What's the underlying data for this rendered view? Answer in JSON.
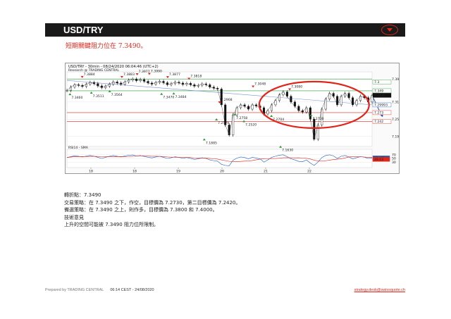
{
  "header": {
    "title": "USD/TRY"
  },
  "headline": "短期關鍵阻力位在  7.3490。",
  "chart": {
    "title": "USD/TRY - 30min - 08/24/2020 06:04:46 (UTC+2)",
    "source": "Research @ TRADING CENTRAL",
    "indicator_label": "RSI14 - SMA",
    "colors": {
      "resistance": "#2a9a3a",
      "support": "#e0251b",
      "ellipse": "#e0251b",
      "arrow": "#1f5fbf",
      "rsi": "#1f5fbf",
      "sma": "#e0251b"
    },
    "price_ticks": [
      {
        "label": "7.39",
        "value": 7.39
      },
      {
        "label": "7.31",
        "value": 7.31
      },
      {
        "label": "7.25",
        "value": 7.25
      },
      {
        "label": "7.19",
        "value": 7.19
      }
    ],
    "price_tags": [
      {
        "label": "7.3",
        "value": 7.38,
        "color": "#2a9a3a"
      },
      {
        "label": "7.349",
        "value": 7.349,
        "color": "#2a9a3a"
      },
      {
        "label": "7.3331",
        "value": 7.3331,
        "color": "#111111"
      },
      {
        "label": "7.29993",
        "value": 7.2999,
        "color": "#1f5fbf"
      },
      {
        "label": "7.273",
        "value": 7.273,
        "color": "#e0251b"
      },
      {
        "label": "7.242",
        "value": 7.242,
        "color": "#e0251b"
      }
    ],
    "rsi_ticks": [
      {
        "label": "70",
        "value": 70
      },
      {
        "label": "50",
        "value": 50
      },
      {
        "label": "30",
        "value": 30
      }
    ],
    "rsi_tags": [
      {
        "label": "52.4724",
        "value": 52.47,
        "color": "#1f5fbf"
      },
      {
        "label": "49.03",
        "value": 45,
        "color": "#e0251b"
      }
    ],
    "date_labels": [
      "18",
      "18",
      "19",
      "20",
      "21",
      "22"
    ],
    "pivot_labels": [
      {
        "label": "7.3884",
        "x": 0.05,
        "value": 7.3884,
        "kind": "high"
      },
      {
        "label": "7.3883",
        "x": 0.18,
        "value": 7.3883,
        "kind": "high"
      },
      {
        "label": "7.3977",
        "x": 0.23,
        "value": 7.3977,
        "kind": "high"
      },
      {
        "label": "7.3990",
        "x": 0.27,
        "value": 7.399,
        "kind": "high"
      },
      {
        "label": "7.3877",
        "x": 0.33,
        "value": 7.3877,
        "kind": "high"
      },
      {
        "label": "7.3818",
        "x": 0.4,
        "value": 7.3818,
        "kind": "high"
      },
      {
        "label": "7.3460",
        "x": 0.01,
        "value": 7.346,
        "kind": "low"
      },
      {
        "label": "7.3511",
        "x": 0.08,
        "value": 7.3511,
        "kind": "low"
      },
      {
        "label": "7.3564",
        "x": 0.14,
        "value": 7.3564,
        "kind": "low"
      },
      {
        "label": "7.3470",
        "x": 0.31,
        "value": 7.347,
        "kind": "low"
      },
      {
        "label": "7.3484",
        "x": 0.35,
        "value": 7.3484,
        "kind": "low"
      },
      {
        "label": "7.3048",
        "x": 0.61,
        "value": 7.3548,
        "kind": "high"
      },
      {
        "label": "7.2968",
        "x": 0.5,
        "value": 7.3,
        "kind": "high"
      },
      {
        "label": "7.2758",
        "x": 0.55,
        "value": 7.2758,
        "kind": "low"
      },
      {
        "label": "7.2704",
        "x": 0.67,
        "value": 7.2704,
        "kind": "low"
      },
      {
        "label": "7.2520",
        "x": 0.58,
        "value": 7.252,
        "kind": "low"
      },
      {
        "label": "7.2579",
        "x": 0.49,
        "value": 7.2579,
        "kind": "low"
      },
      {
        "label": "7.1885",
        "x": 0.45,
        "value": 7.1885,
        "kind": "low"
      },
      {
        "label": "7.1630",
        "x": 0.7,
        "value": 7.163,
        "kind": "low"
      },
      {
        "label": "7.3080",
        "x": 0.73,
        "value": 7.345,
        "kind": "high"
      },
      {
        "label": "7.2730",
        "x": 0.8,
        "value": 7.273,
        "kind": "low"
      }
    ]
  },
  "chart_data": {
    "type": "line",
    "x": [
      0,
      1,
      2,
      3,
      4,
      5,
      6,
      7,
      8,
      9,
      10,
      11,
      12,
      13,
      14,
      15,
      16,
      17,
      18,
      19,
      20,
      21,
      22,
      23,
      24,
      25,
      26,
      27,
      28,
      29,
      30,
      31,
      32,
      33,
      34,
      35,
      36,
      37,
      38,
      39,
      40,
      41,
      42,
      43,
      44,
      45,
      46,
      47,
      48,
      49,
      50,
      51,
      52,
      53,
      54,
      55,
      56,
      57,
      58,
      59,
      60,
      61,
      62,
      63,
      64,
      65,
      66,
      67,
      68,
      69,
      70,
      71,
      72,
      73,
      74,
      75,
      76,
      77,
      78,
      79
    ],
    "series": [
      {
        "values": [
          7.35,
          7.362,
          7.37,
          7.368,
          7.364,
          7.372,
          7.378,
          7.374,
          7.366,
          7.36,
          7.365,
          7.372,
          7.38,
          7.376,
          7.372,
          7.38,
          7.386,
          7.39,
          7.384,
          7.388,
          7.382,
          7.376,
          7.372,
          7.378,
          7.382,
          7.377,
          7.37,
          7.374,
          7.379,
          7.376,
          7.371,
          7.375,
          7.37,
          7.365,
          7.368,
          7.373,
          7.37,
          7.362,
          7.358,
          7.355,
          7.3,
          7.23,
          7.195,
          7.265,
          7.29,
          7.3,
          7.295,
          7.285,
          7.3,
          7.296,
          7.29,
          7.268,
          7.28,
          7.3,
          7.315,
          7.335,
          7.345,
          7.33,
          7.31,
          7.295,
          7.28,
          7.275,
          7.29,
          7.25,
          7.18,
          7.23,
          7.285,
          7.32,
          7.34,
          7.33,
          7.3,
          7.33,
          7.34,
          7.325,
          7.3,
          7.315,
          7.33,
          7.325,
          7.31,
          7.333
        ]
      }
    ],
    "rsi": {
      "values": [
        55,
        60,
        64,
        62,
        58,
        63,
        66,
        62,
        56,
        50,
        56,
        62,
        66,
        62,
        58,
        64,
        67,
        69,
        63,
        66,
        61,
        56,
        53,
        58,
        61,
        56,
        50,
        54,
        59,
        56,
        51,
        55,
        50,
        45,
        48,
        54,
        50,
        42,
        38,
        35,
        18,
        12,
        10,
        40,
        52,
        58,
        55,
        48,
        56,
        52,
        48,
        30,
        42,
        56,
        62,
        68,
        70,
        60,
        48,
        42,
        34,
        32,
        42,
        25,
        12,
        30,
        55,
        66,
        70,
        64,
        50,
        62,
        66,
        58,
        48,
        54,
        60,
        57,
        50,
        52
      ]
    },
    "forecast_arrow": {
      "from": 7.323,
      "to": 7.26
    },
    "resistance": [
      7.39,
      7.349
    ],
    "support": [
      7.273,
      7.242
    ],
    "sma_line_from": 7.385,
    "sma_line_to": 7.3,
    "ylim": [
      7.155,
      7.415
    ],
    "rsi_ylim": [
      0,
      100
    ]
  },
  "body": {
    "pivot": "轉折點：7.3490",
    "strategy": "交易策略：在 7.3490 之下，作空，目標價為 7.2730，第二目標價為 7.2420。",
    "alternative": "備選策略：在 7.3490 之上，則作多，目標價為 7.3800 和 7.4000。",
    "comment_title": "技術意見",
    "comment": "上升的空間可能被 7.3490 阻力位所限制。"
  },
  "footer": {
    "prepared": "Prepared by TRADING CENTRAL",
    "timestamp": "06:14 CEST - 24/08/2020",
    "email": "strategy.desk@swissquote.ch"
  }
}
